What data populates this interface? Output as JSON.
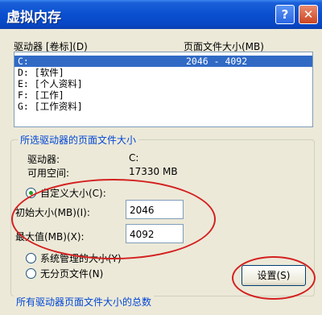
{
  "window": {
    "title": "虚拟内存",
    "help_label": "?",
    "close_label": "✕"
  },
  "drive_list": {
    "col_drive": "驱动器 [卷标](D)",
    "col_size": "页面文件大小(MB)",
    "rows": [
      {
        "drive": "C:",
        "size": "2046 - 4092"
      },
      {
        "drive": "D:   [软件]",
        "size": ""
      },
      {
        "drive": "E:   [个人资料]",
        "size": ""
      },
      {
        "drive": "F:   [工作]",
        "size": ""
      },
      {
        "drive": "G:   [工作资料]",
        "size": ""
      }
    ]
  },
  "selected_drive": {
    "group_title": "所选驱动器的页面文件大小",
    "drive_label": "驱动器:",
    "drive_value": "C:",
    "space_label": "可用空间:",
    "space_value": "17330 MB",
    "custom_label": "自定义大小(C):",
    "initial_label": "初始大小(MB)(I):",
    "initial_value": "2046",
    "max_label": "最大值(MB)(X):",
    "max_value": "4092",
    "system_label": "系统管理的大小(Y)",
    "none_label": "无分页文件(N)",
    "set_button": "设置(S)"
  },
  "totals": {
    "group_title": "所有驱动器页面文件大小的总数"
  },
  "colors": {
    "annotation": "#d42020",
    "selection": "#316ac5",
    "group_title": "#0046d5"
  }
}
